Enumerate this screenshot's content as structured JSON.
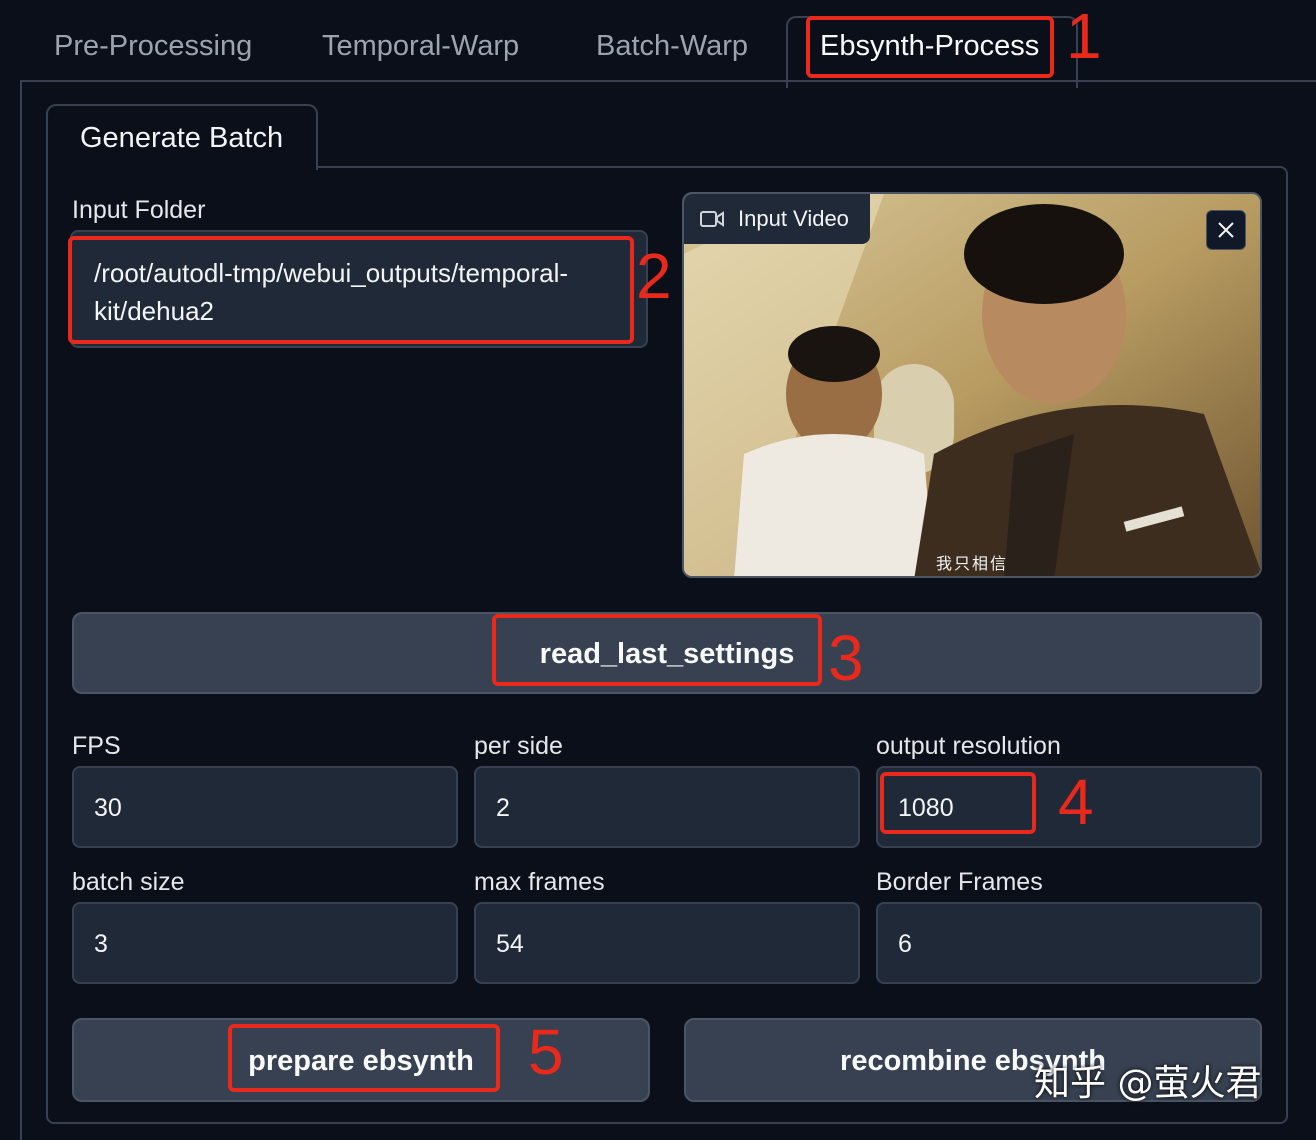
{
  "tabs": [
    {
      "label": "Pre-Processing",
      "active": false
    },
    {
      "label": "Temporal-Warp",
      "active": false
    },
    {
      "label": "Batch-Warp",
      "active": false
    },
    {
      "label": "Ebsynth-Process",
      "active": true
    }
  ],
  "sub_tab": {
    "label": "Generate Batch"
  },
  "input_folder": {
    "label": "Input Folder",
    "value_line1": "/root/autodl-tmp/webui_outputs/temporal-",
    "value_line2": "kit/dehua2"
  },
  "input_video": {
    "label": "Input Video",
    "subtitle": "我只相信"
  },
  "read_settings_button": "read_last_settings",
  "fields": {
    "fps": {
      "label": "FPS",
      "value": "30"
    },
    "per_side": {
      "label": "per side",
      "value": "2"
    },
    "output_resolution": {
      "label": "output resolution",
      "value": "1080"
    },
    "batch_size": {
      "label": "batch size",
      "value": "3"
    },
    "max_frames": {
      "label": "max frames",
      "value": "54"
    },
    "border_frames": {
      "label": "Border Frames",
      "value": "6"
    }
  },
  "prepare_button": "prepare ebsynth",
  "recombine_button": "recombine ebsynth",
  "annotations": [
    "1",
    "2",
    "3",
    "4",
    "5"
  ],
  "watermark": "知乎 @萤火君",
  "colors": {
    "annotation": "#e8291c",
    "background": "#0b0f19",
    "input_bg": "#1f2937",
    "button_bg": "#374151"
  }
}
